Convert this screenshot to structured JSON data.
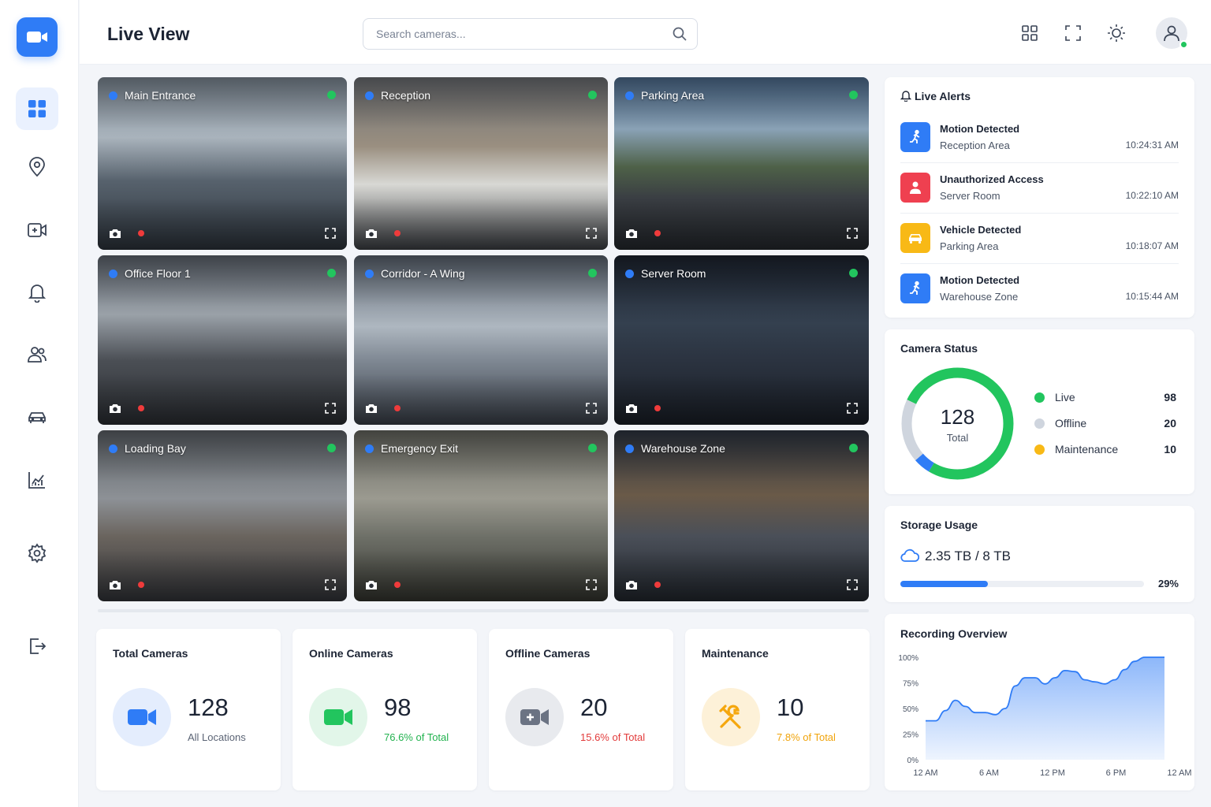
{
  "header": {
    "title": "Live View",
    "search_placeholder": "Search cameras..."
  },
  "sidebar": {
    "items": [
      {
        "name": "dashboard",
        "active": true
      },
      {
        "name": "locations",
        "active": false
      },
      {
        "name": "cameras",
        "active": false
      },
      {
        "name": "alerts",
        "active": false
      },
      {
        "name": "users",
        "active": false
      },
      {
        "name": "vehicles",
        "active": false
      },
      {
        "name": "analytics",
        "active": false
      },
      {
        "name": "settings",
        "active": false
      },
      {
        "name": "logout",
        "active": false
      }
    ]
  },
  "cameras": [
    {
      "name": "Main Entrance"
    },
    {
      "name": "Reception"
    },
    {
      "name": "Parking Area"
    },
    {
      "name": "Office Floor 1"
    },
    {
      "name": "Corridor - A Wing"
    },
    {
      "name": "Server Room"
    },
    {
      "name": "Loading Bay"
    },
    {
      "name": "Emergency Exit"
    },
    {
      "name": "Warehouse Zone"
    }
  ],
  "alerts": {
    "title": "Live Alerts",
    "items": [
      {
        "title": "Motion Detected",
        "location": "Reception Area",
        "time": "10:24:31 AM",
        "icon": "running-person-icon",
        "color": "#2f7cf6"
      },
      {
        "title": "Unauthorized Access",
        "location": "Server Room",
        "time": "10:22:10 AM",
        "icon": "person-icon",
        "color": "#ef4050"
      },
      {
        "title": "Vehicle Detected",
        "location": "Parking Area",
        "time": "10:18:07 AM",
        "icon": "car-icon",
        "color": "#f8b916"
      },
      {
        "title": "Motion Detected",
        "location": "Warehouse Zone",
        "time": "10:15:44 AM",
        "icon": "running-person-icon",
        "color": "#2f7cf6"
      }
    ]
  },
  "camera_status": {
    "title": "Camera Status",
    "total": "128",
    "total_label": "Total",
    "items": [
      {
        "label": "Live",
        "value": "98",
        "color": "#22c55e"
      },
      {
        "label": "Offline",
        "value": "20",
        "color": "#cfd5de"
      },
      {
        "label": "Maintenance",
        "value": "10",
        "color": "#f8b916"
      }
    ],
    "donut_accent": "#2f7cf6",
    "donut_accent_fraction": 0.05
  },
  "storage": {
    "title": "Storage Usage",
    "used": "2.35 TB",
    "separator": " / ",
    "total": "8 TB",
    "percent_label": "29%",
    "percent": 29
  },
  "kpis": [
    {
      "title": "Total Cameras",
      "value": "128",
      "sub": "All Locations",
      "color": "#2f7cf6",
      "bg": "#e4edfd",
      "sub_color": "#5b6475"
    },
    {
      "title": "Online Cameras",
      "value": "98",
      "sub": "76.6% of Total",
      "color": "#22c55e",
      "bg": "#e2f6e9",
      "sub_color": "#22b24f"
    },
    {
      "title": "Offline Cameras",
      "value": "20",
      "sub": "15.6% of Total",
      "color": "#6b7383",
      "bg": "#e8eaee",
      "sub_color": "#e23b3b"
    },
    {
      "title": "Maintenance",
      "value": "10",
      "sub": "7.8% of Total",
      "color": "#f5a70d",
      "bg": "#fdf1d8",
      "sub_color": "#f0a30a"
    }
  ],
  "chart_data": {
    "type": "area",
    "title": "Recording Overview",
    "x_ticks": [
      "12 AM",
      "6 AM",
      "12 PM",
      "6 PM",
      "12 AM"
    ],
    "y_ticks": [
      "100%",
      "75%",
      "50%",
      "25%",
      "0%"
    ],
    "ylim": [
      0,
      100
    ],
    "x": [
      0,
      1,
      2,
      3,
      4,
      5,
      6,
      7,
      8,
      9,
      10,
      11,
      12,
      13,
      14,
      15,
      16,
      17,
      18,
      19,
      20,
      21,
      22,
      23,
      24
    ],
    "values": [
      38,
      38,
      48,
      58,
      52,
      46,
      46,
      44,
      50,
      72,
      80,
      80,
      74,
      80,
      87,
      86,
      78,
      76,
      74,
      78,
      88,
      96,
      100,
      100,
      100
    ],
    "color": "#2f7cf6"
  }
}
